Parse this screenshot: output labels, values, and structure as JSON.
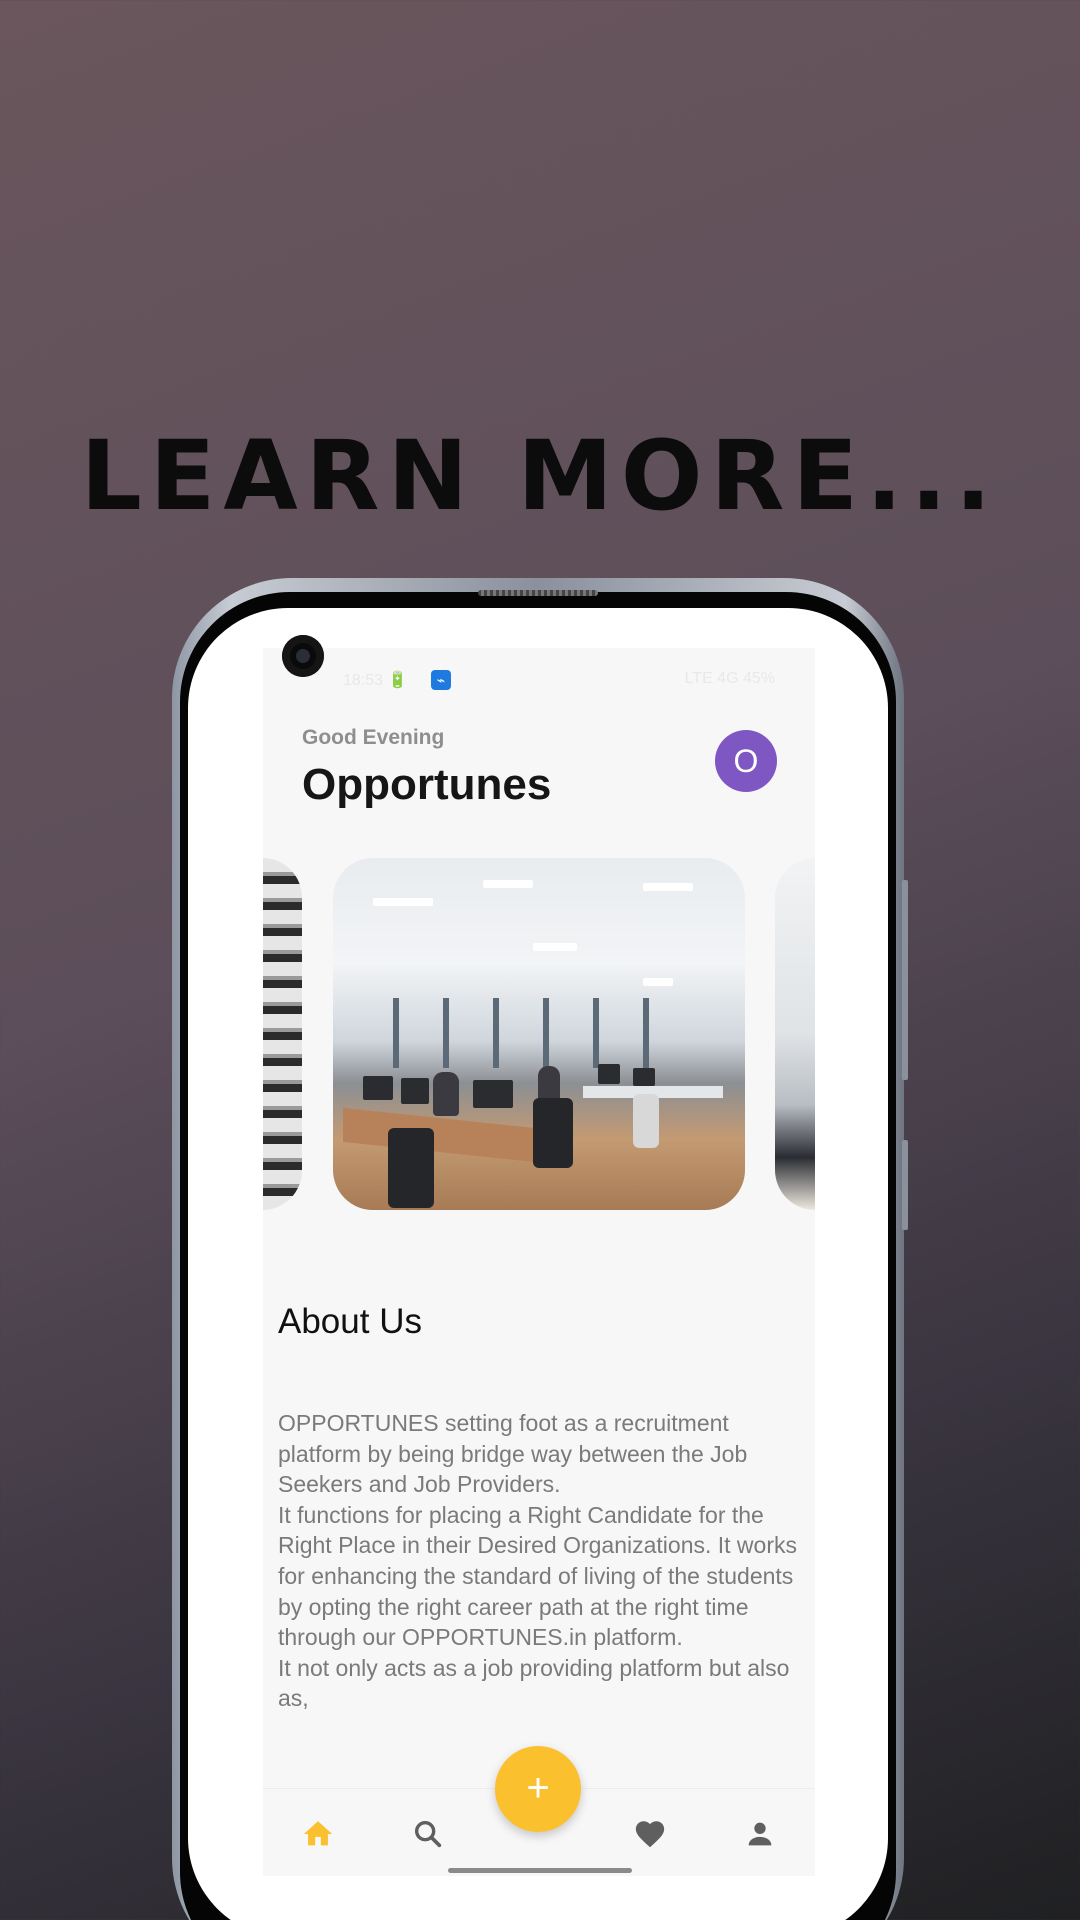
{
  "promo": {
    "headline": "LEARN MORE..."
  },
  "status_bar": {
    "left": "18:53 🔋",
    "usb_icon": "usb-icon",
    "right": "LTE 4G 45%"
  },
  "header": {
    "greeting": "Good Evening",
    "title": "Opportunes",
    "avatar_letter": "O"
  },
  "carousel": {
    "cards": [
      {
        "id": "prev",
        "image": "staircase-photo"
      },
      {
        "id": "current",
        "image": "open-office-photo"
      },
      {
        "id": "next",
        "image": "office-person-photo"
      }
    ]
  },
  "about": {
    "title": "About Us",
    "paragraphs": [
      "OPPORTUNES setting foot as a recruitment platform by being bridge way between the Job Seekers and Job Providers.",
      "It functions for placing a Right Candidate for the Right Place in their Desired Organizations. It works for enhancing the standard of living of the students by opting the right career path at the right time through our OPPORTUNES.in platform.",
      "It not only acts as a job providing platform but also as,"
    ]
  },
  "fab": {
    "label": "+",
    "icon": "plus-icon"
  },
  "bottom_nav": {
    "items": [
      {
        "icon": "home-icon",
        "active": true
      },
      {
        "icon": "search-icon",
        "active": false
      },
      {
        "icon": "heart-icon",
        "active": false
      },
      {
        "icon": "person-icon",
        "active": false
      }
    ]
  },
  "colors": {
    "accent": "#fbc02d",
    "avatar": "#7e57c2",
    "nav_inactive": "#5f5f5f",
    "background_gradient": [
      "#6a565c",
      "#1f2022"
    ]
  }
}
